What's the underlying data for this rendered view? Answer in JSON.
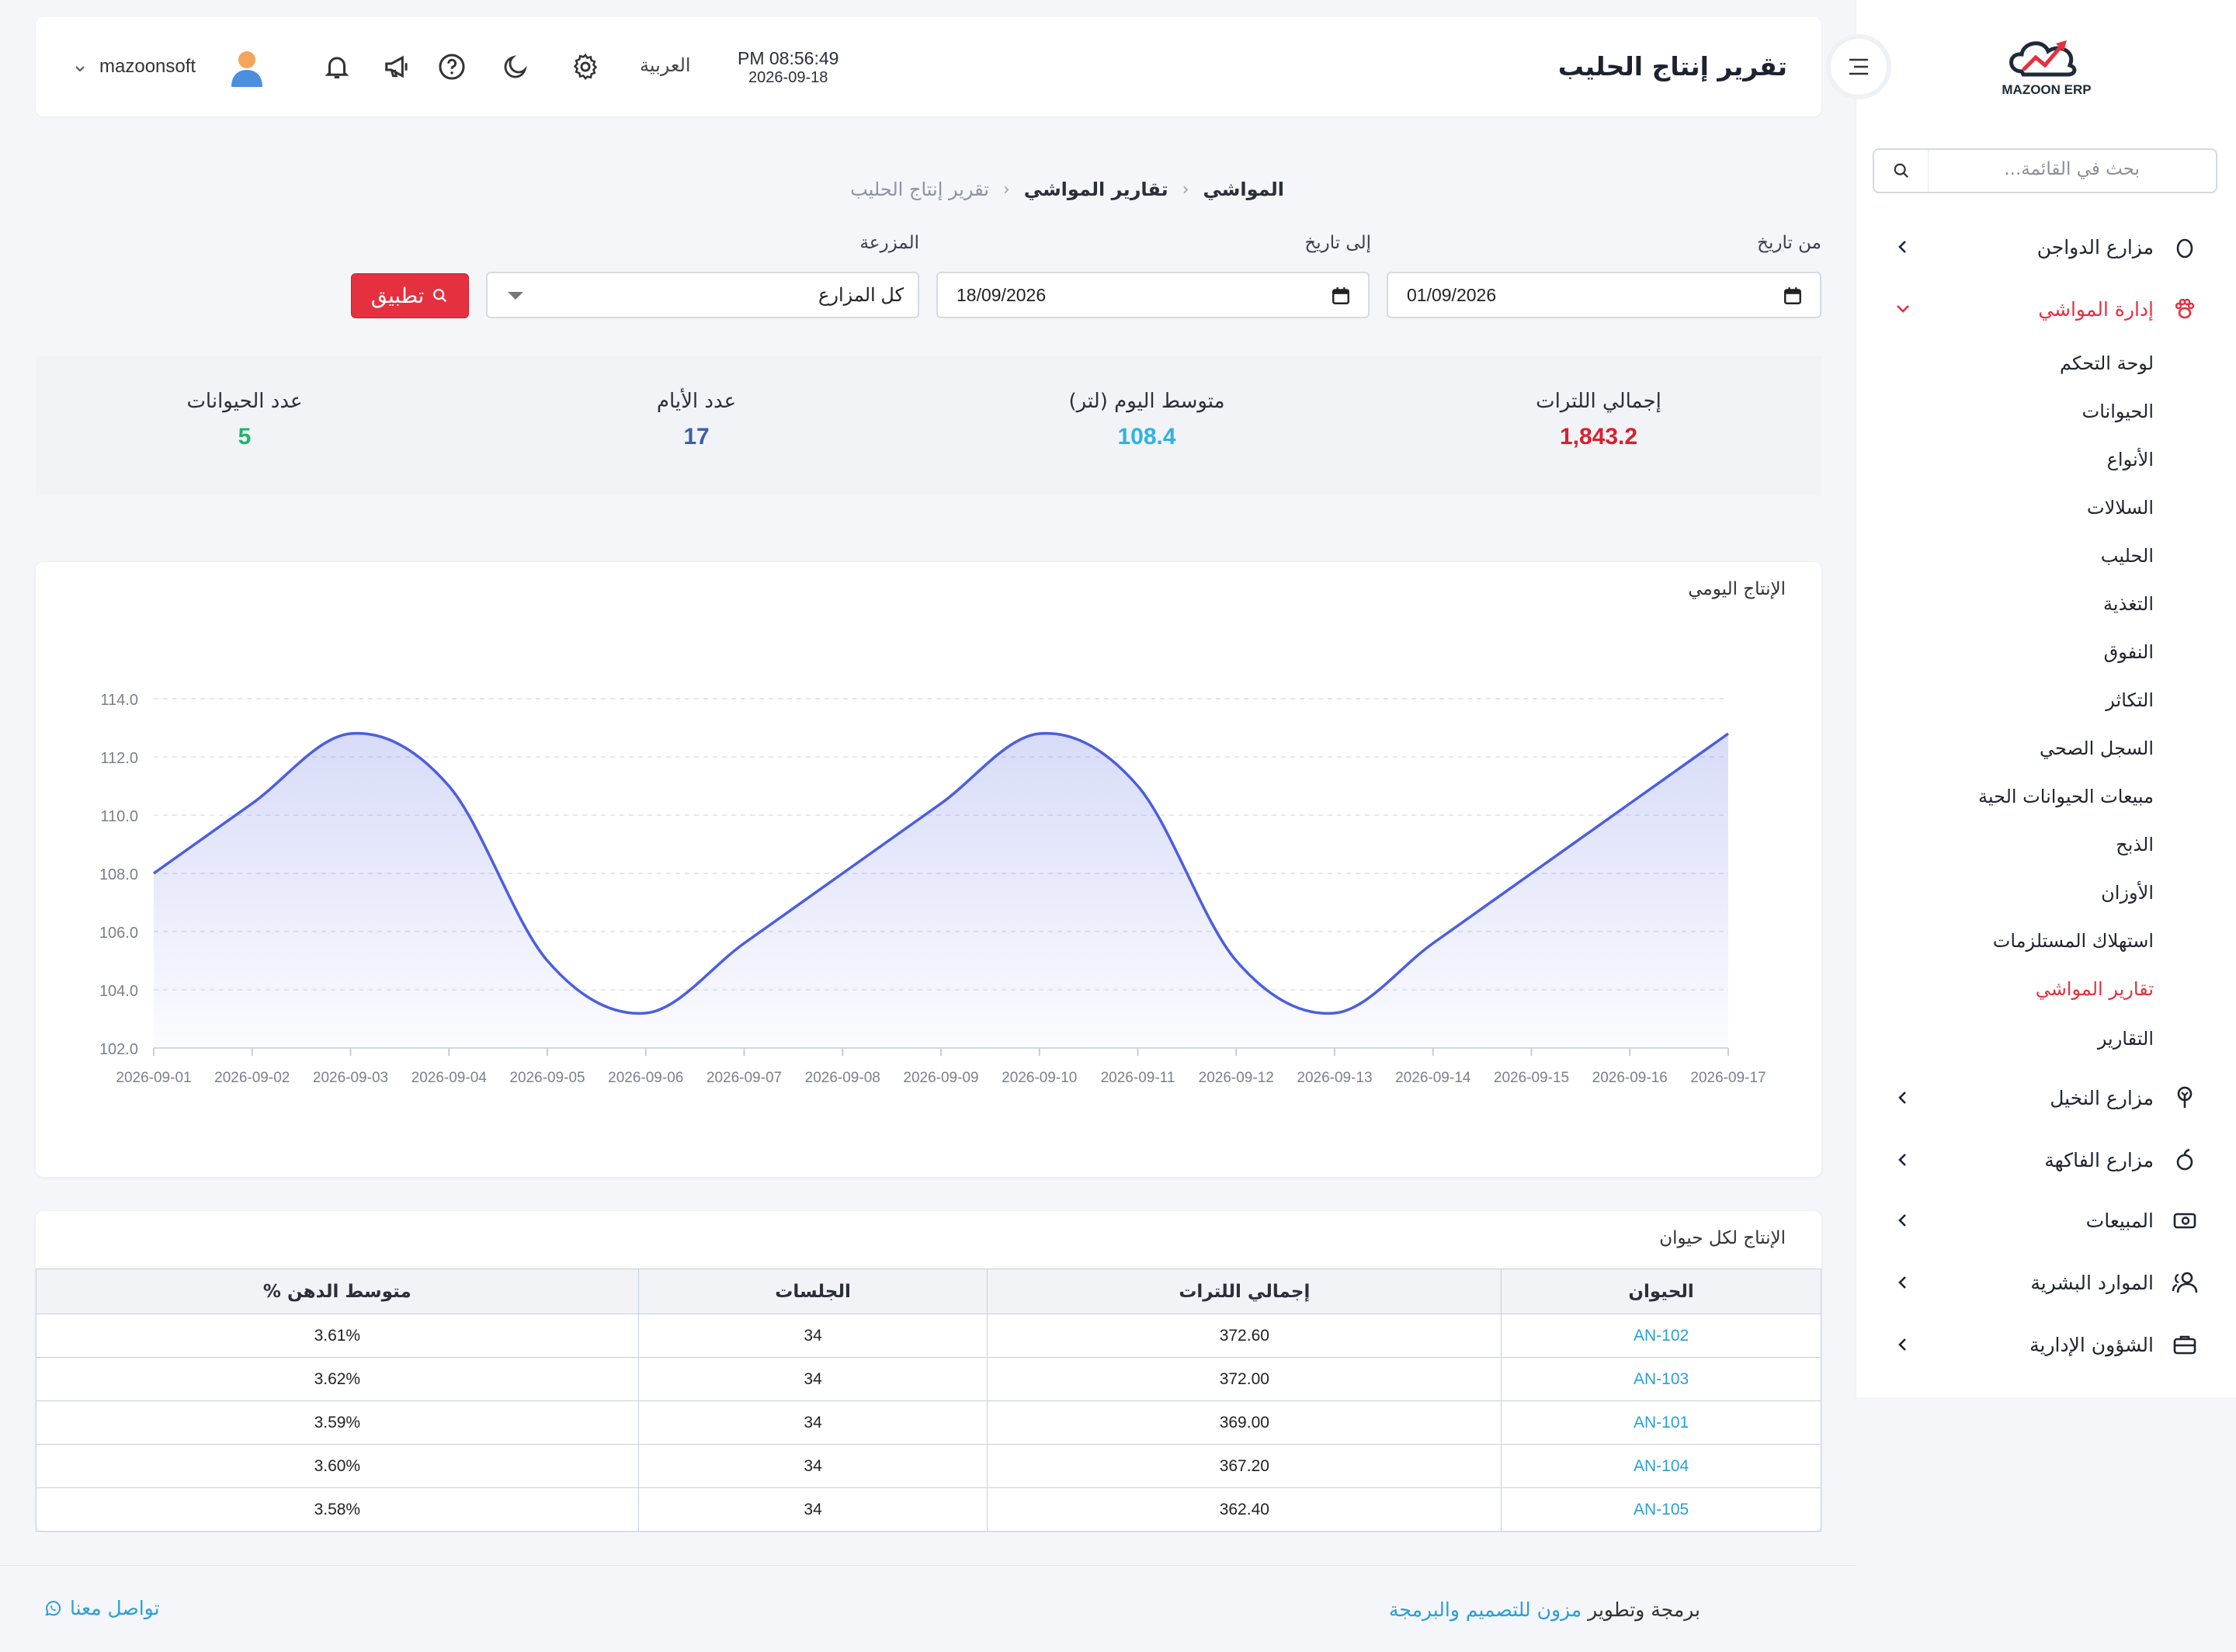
{
  "sidebar": {
    "logo_text": "MAZOON ERP",
    "search_placeholder": "بحث في القائمة...",
    "items": [
      {
        "label": "مزارع الدواجن",
        "icon": "egg-icon"
      },
      {
        "label": "إدارة المواشي",
        "icon": "paw-icon"
      },
      {
        "label": "مزارع النخيل",
        "icon": "palm-icon"
      },
      {
        "label": "مزارع الفاكهة",
        "icon": "fruit-icon"
      },
      {
        "label": "المبيعات",
        "icon": "cash-icon"
      },
      {
        "label": "الموارد البشرية",
        "icon": "users-icon"
      },
      {
        "label": "الشؤون الإدارية",
        "icon": "briefcase-icon"
      }
    ],
    "sub_items": [
      "لوحة التحكم",
      "الحيوانات",
      "الأنواع",
      "السلالات",
      "الحليب",
      "التغذية",
      "النفوق",
      "التكاثر",
      "السجل الصحي",
      "مبيعات الحيوانات الحية",
      "الذبح",
      "الأوزان",
      "استهلاك المستلزمات",
      "تقارير المواشي",
      "التقارير"
    ],
    "active_sub": "تقارير المواشي"
  },
  "topbar": {
    "title": "تقرير إنتاج الحليب",
    "time": "PM 08:56:49",
    "date": "2026-09-18",
    "language": "العربية",
    "username": "mazoonsoft"
  },
  "breadcrumb": [
    "المواشي",
    "تقارير المواشي",
    "تقرير إنتاج الحليب"
  ],
  "filters": {
    "from_label": "من تاريخ",
    "from_value": "01/09/2026",
    "to_label": "إلى تاريخ",
    "to_value": "18/09/2026",
    "farm_label": "المزرعة",
    "farm_value": "كل المزارع",
    "apply_label": "تطبيق"
  },
  "stats": [
    {
      "label": "إجمالي اللترات",
      "value": "1,843.2",
      "color": "#d9202e"
    },
    {
      "label": "متوسط اليوم (لتر)",
      "value": "108.4",
      "color": "#2fb2e0"
    },
    {
      "label": "عدد الأيام",
      "value": "17",
      "color": "#3d5ea8"
    },
    {
      "label": "عدد الحيوانات",
      "value": "5",
      "color": "#1fb56b"
    }
  ],
  "chart_data": {
    "type": "area",
    "title": "الإنتاج اليومي",
    "x": [
      "2026-09-01",
      "2026-09-02",
      "2026-09-03",
      "2026-09-04",
      "2026-09-05",
      "2026-09-06",
      "2026-09-07",
      "2026-09-08",
      "2026-09-09",
      "2026-09-10",
      "2026-09-11",
      "2026-09-12",
      "2026-09-13",
      "2026-09-14",
      "2026-09-15",
      "2026-09-16",
      "2026-09-17"
    ],
    "values": [
      108.0,
      110.4,
      112.8,
      111.0,
      105.0,
      103.2,
      105.6,
      108.0,
      110.4,
      112.8,
      111.0,
      105.0,
      103.2,
      105.6,
      108.0,
      110.4,
      112.8
    ],
    "ylim": [
      102.0,
      114.0
    ],
    "yticks": [
      "102.0",
      "104.0",
      "106.0",
      "108.0",
      "110.0",
      "112.0",
      "114.0"
    ],
    "line_color": "#4b5ee0",
    "grid": true
  },
  "table": {
    "title": "الإنتاج لكل حيوان",
    "headers": [
      "الحيوان",
      "إجمالي اللترات",
      "الجلسات",
      "متوسط الدهن %"
    ],
    "rows": [
      [
        "AN-102",
        "372.60",
        "34",
        "3.61%"
      ],
      [
        "AN-103",
        "372.00",
        "34",
        "3.62%"
      ],
      [
        "AN-101",
        "369.00",
        "34",
        "3.59%"
      ],
      [
        "AN-104",
        "367.20",
        "34",
        "3.60%"
      ],
      [
        "AN-105",
        "362.40",
        "34",
        "3.58%"
      ]
    ]
  },
  "footer": {
    "prefix": "برمجة وتطوير",
    "company_link": "مزون للتصميم والبرمجة",
    "contact": "تواصل معنا"
  }
}
